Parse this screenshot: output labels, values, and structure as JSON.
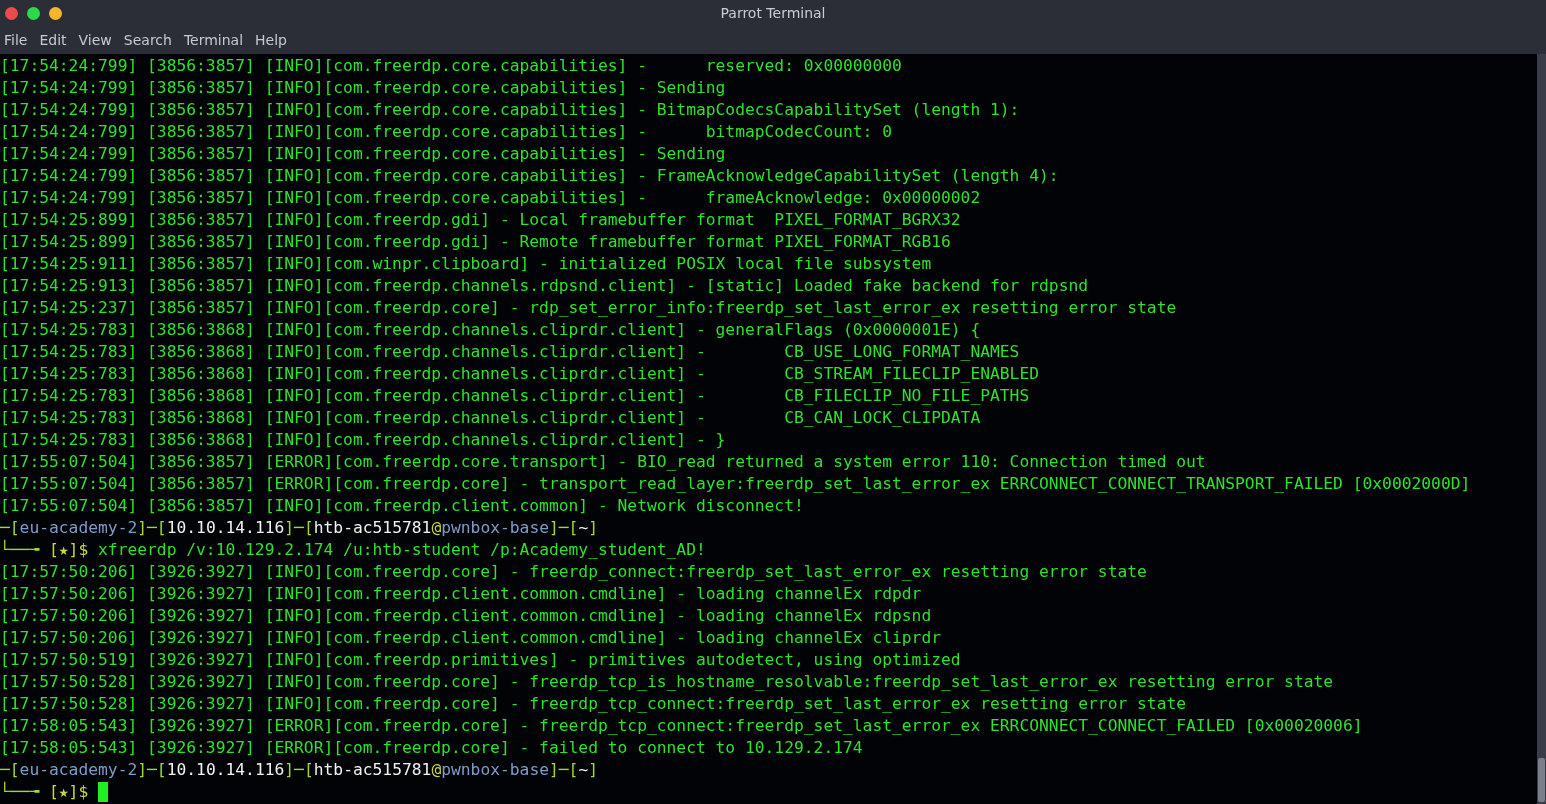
{
  "window": {
    "title": "Parrot Terminal"
  },
  "menu": [
    "File",
    "Edit",
    "View",
    "Search",
    "Terminal",
    "Help"
  ],
  "lines": [
    {
      "kind": "log",
      "text": "[17:54:24:799] [3856:3857] [INFO][com.freerdp.core.capabilities] -      reserved: 0x00000000"
    },
    {
      "kind": "log",
      "text": "[17:54:24:799] [3856:3857] [INFO][com.freerdp.core.capabilities] - Sending"
    },
    {
      "kind": "log",
      "text": "[17:54:24:799] [3856:3857] [INFO][com.freerdp.core.capabilities] - BitmapCodecsCapabilitySet (length 1):"
    },
    {
      "kind": "log",
      "text": "[17:54:24:799] [3856:3857] [INFO][com.freerdp.core.capabilities] -      bitmapCodecCount: 0"
    },
    {
      "kind": "log",
      "text": "[17:54:24:799] [3856:3857] [INFO][com.freerdp.core.capabilities] - Sending"
    },
    {
      "kind": "log",
      "text": "[17:54:24:799] [3856:3857] [INFO][com.freerdp.core.capabilities] - FrameAcknowledgeCapabilitySet (length 4):"
    },
    {
      "kind": "log",
      "text": "[17:54:24:799] [3856:3857] [INFO][com.freerdp.core.capabilities] -      frameAcknowledge: 0x00000002"
    },
    {
      "kind": "log",
      "text": "[17:54:25:899] [3856:3857] [INFO][com.freerdp.gdi] - Local framebuffer format  PIXEL_FORMAT_BGRX32"
    },
    {
      "kind": "log",
      "text": "[17:54:25:899] [3856:3857] [INFO][com.freerdp.gdi] - Remote framebuffer format PIXEL_FORMAT_RGB16"
    },
    {
      "kind": "log",
      "text": "[17:54:25:911] [3856:3857] [INFO][com.winpr.clipboard] - initialized POSIX local file subsystem"
    },
    {
      "kind": "log",
      "text": "[17:54:25:913] [3856:3857] [INFO][com.freerdp.channels.rdpsnd.client] - [static] Loaded fake backend for rdpsnd"
    },
    {
      "kind": "log",
      "text": "[17:54:25:237] [3856:3857] [INFO][com.freerdp.core] - rdp_set_error_info:freerdp_set_last_error_ex resetting error state"
    },
    {
      "kind": "log",
      "text": "[17:54:25:783] [3856:3868] [INFO][com.freerdp.channels.cliprdr.client] - generalFlags (0x0000001E) {"
    },
    {
      "kind": "log",
      "text": "[17:54:25:783] [3856:3868] [INFO][com.freerdp.channels.cliprdr.client] -        CB_USE_LONG_FORMAT_NAMES"
    },
    {
      "kind": "log",
      "text": "[17:54:25:783] [3856:3868] [INFO][com.freerdp.channels.cliprdr.client] -        CB_STREAM_FILECLIP_ENABLED"
    },
    {
      "kind": "log",
      "text": "[17:54:25:783] [3856:3868] [INFO][com.freerdp.channels.cliprdr.client] -        CB_FILECLIP_NO_FILE_PATHS"
    },
    {
      "kind": "log",
      "text": "[17:54:25:783] [3856:3868] [INFO][com.freerdp.channels.cliprdr.client] -        CB_CAN_LOCK_CLIPDATA"
    },
    {
      "kind": "log",
      "text": "[17:54:25:783] [3856:3868] [INFO][com.freerdp.channels.cliprdr.client] - }"
    },
    {
      "kind": "log",
      "text": "[17:55:07:504] [3856:3857] [ERROR][com.freerdp.core.transport] - BIO_read returned a system error 110: Connection timed out"
    },
    {
      "kind": "log",
      "text": "[17:55:07:504] [3856:3857] [ERROR][com.freerdp.core] - transport_read_layer:freerdp_set_last_error_ex ERRCONNECT_CONNECT_TRANSPORT_FAILED [0x0002000D]"
    },
    {
      "kind": "log",
      "text": "[17:55:07:504] [3856:3857] [INFO][com.freerdp.client.common] - Network disconnect!"
    },
    {
      "kind": "prompt",
      "parts": [
        {
          "text": "─[",
          "color": "#9fd83a"
        },
        {
          "text": "eu-academy-2",
          "color": "#7f9cc8"
        },
        {
          "text": "]─[",
          "color": "#9fd83a"
        },
        {
          "text": "10.10.14.116",
          "color": "#f2f2f2"
        },
        {
          "text": "]─[",
          "color": "#9fd83a"
        },
        {
          "text": "htb-ac515781",
          "color": "#f2f2f2"
        },
        {
          "text": "@",
          "color": "#c9d83a"
        },
        {
          "text": "pwnbox-base",
          "color": "#7f9cc8"
        },
        {
          "text": "]─[",
          "color": "#9fd83a"
        },
        {
          "text": "~",
          "color": "#f2f2f2"
        },
        {
          "text": "]",
          "color": "#9fd83a"
        }
      ]
    },
    {
      "kind": "input",
      "cursor": false,
      "parts": [
        {
          "text": "└──╼ ",
          "color": "#9fd83a"
        },
        {
          "text": "[★]$ ",
          "color": "#c9d83a"
        },
        {
          "text": "xfreerdp /v:10.129.2.174 /u:htb-student /p:Academy_student_AD!",
          "color": "#2fe02f"
        }
      ]
    },
    {
      "kind": "log",
      "text": "[17:57:50:206] [3926:3927] [INFO][com.freerdp.core] - freerdp_connect:freerdp_set_last_error_ex resetting error state"
    },
    {
      "kind": "log",
      "text": "[17:57:50:206] [3926:3927] [INFO][com.freerdp.client.common.cmdline] - loading channelEx rdpdr"
    },
    {
      "kind": "log",
      "text": "[17:57:50:206] [3926:3927] [INFO][com.freerdp.client.common.cmdline] - loading channelEx rdpsnd"
    },
    {
      "kind": "log",
      "text": "[17:57:50:206] [3926:3927] [INFO][com.freerdp.client.common.cmdline] - loading channelEx cliprdr"
    },
    {
      "kind": "log",
      "text": "[17:57:50:519] [3926:3927] [INFO][com.freerdp.primitives] - primitives autodetect, using optimized"
    },
    {
      "kind": "log",
      "text": "[17:57:50:528] [3926:3927] [INFO][com.freerdp.core] - freerdp_tcp_is_hostname_resolvable:freerdp_set_last_error_ex resetting error state"
    },
    {
      "kind": "log",
      "text": "[17:57:50:528] [3926:3927] [INFO][com.freerdp.core] - freerdp_tcp_connect:freerdp_set_last_error_ex resetting error state"
    },
    {
      "kind": "log",
      "text": "[17:58:05:543] [3926:3927] [ERROR][com.freerdp.core] - freerdp_tcp_connect:freerdp_set_last_error_ex ERRCONNECT_CONNECT_FAILED [0x00020006]"
    },
    {
      "kind": "log",
      "text": "[17:58:05:543] [3926:3927] [ERROR][com.freerdp.core] - failed to connect to 10.129.2.174"
    },
    {
      "kind": "prompt",
      "parts": [
        {
          "text": "─[",
          "color": "#9fd83a"
        },
        {
          "text": "eu-academy-2",
          "color": "#7f9cc8"
        },
        {
          "text": "]─[",
          "color": "#9fd83a"
        },
        {
          "text": "10.10.14.116",
          "color": "#f2f2f2"
        },
        {
          "text": "]─[",
          "color": "#9fd83a"
        },
        {
          "text": "htb-ac515781",
          "color": "#f2f2f2"
        },
        {
          "text": "@",
          "color": "#c9d83a"
        },
        {
          "text": "pwnbox-base",
          "color": "#7f9cc8"
        },
        {
          "text": "]─[",
          "color": "#9fd83a"
        },
        {
          "text": "~",
          "color": "#f2f2f2"
        },
        {
          "text": "]",
          "color": "#9fd83a"
        }
      ]
    },
    {
      "kind": "input",
      "cursor": true,
      "parts": [
        {
          "text": "└──╼ ",
          "color": "#9fd83a"
        },
        {
          "text": "[★]$ ",
          "color": "#c9d83a"
        }
      ]
    }
  ]
}
